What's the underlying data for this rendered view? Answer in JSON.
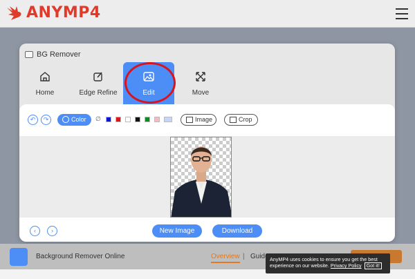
{
  "header": {
    "brand": "ANYMP4",
    "brand_color": "#e03a2a"
  },
  "modal": {
    "title": "BG Remover",
    "tabs": [
      {
        "label": "Home",
        "icon": "home-icon"
      },
      {
        "label": "Edge Refine",
        "icon": "edit-square-icon"
      },
      {
        "label": "Edit",
        "icon": "image-icon",
        "active": true
      },
      {
        "label": "Move",
        "icon": "move-arrows-icon"
      }
    ],
    "toolbar": {
      "color_label": "Color",
      "no_color": "∅",
      "swatches": [
        "#0a17d8",
        "#e01414",
        "#ffffff",
        "#111111",
        "#0e8a24",
        "#f6b9c5",
        "#c7d6f7"
      ],
      "image_label": "Image",
      "crop_label": "Crop"
    },
    "bottom": {
      "new_image": "New Image",
      "download": "Download"
    },
    "accent": "#4c8df6"
  },
  "footer": {
    "product": "Background Remover Online",
    "overview": "Overview",
    "separator": "|",
    "guide": "Guide"
  },
  "cookie": {
    "line1": "AnyMP4 uses cookies to ensure you get the best",
    "line2": "experience on our website.",
    "policy": "Privacy Policy",
    "got_it": "Got it!"
  }
}
